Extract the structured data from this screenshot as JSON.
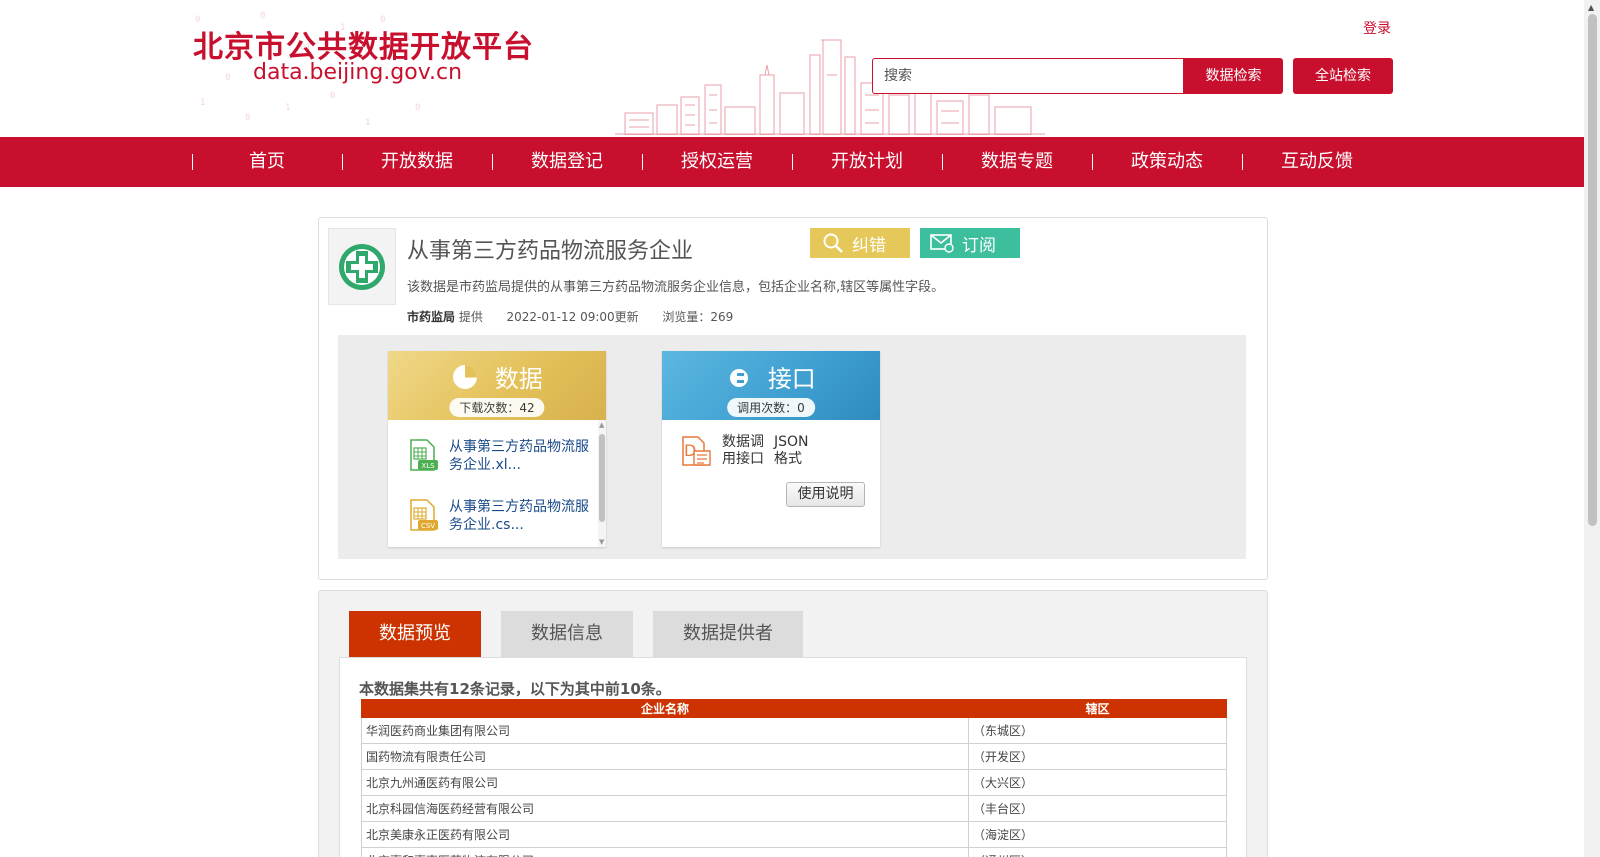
{
  "header": {
    "site_title": "北京市公共数据开放平台",
    "site_url": "data.beijing.gov.cn",
    "login_label": "登录",
    "search_placeholder": "搜索",
    "data_search_label": "数据检索",
    "site_search_label": "全站检索",
    "brand_color": "#c8102e"
  },
  "nav": {
    "items": [
      "首页",
      "开放数据",
      "数据登记",
      "授权运营",
      "开放计划",
      "数据专题",
      "政策动态",
      "互动反馈"
    ]
  },
  "dataset": {
    "icon": "medical-cross-icon",
    "title": "从事第三方药品物流服务企业",
    "correct_label": "纠错",
    "subscribe_label": "订阅",
    "description": "该数据是市药监局提供的从事第三方药品物流服务企业信息，包括企业名称,辖区等属性字段。",
    "provider": "市药监局",
    "provider_suffix": "提供",
    "updated": "2022-01-12 09:00更新",
    "views": "浏览量：269"
  },
  "resources": {
    "data": {
      "title": "数据",
      "count": "下载次数：42",
      "files": [
        {
          "icon": "xls-file-icon",
          "label": "从事第三方药品物流服务企业.xl..."
        },
        {
          "icon": "csv-file-icon",
          "label": "从事第三方药品物流服务企业.cs..."
        }
      ]
    },
    "api": {
      "title": "接口",
      "count": "调用次数：0",
      "item_label": "数据调用接口",
      "format": "JSON格式",
      "usage_label": "使用说明"
    }
  },
  "tabs": {
    "preview": "数据预览",
    "info": "数据信息",
    "provider": "数据提供者",
    "active": "数据预览"
  },
  "preview": {
    "summary": "本数据集共有12条记录，以下为其中前10条。",
    "columns": [
      "企业名称",
      "辖区"
    ],
    "rows": [
      [
        "华润医药商业集团有限公司",
        "（东城区）"
      ],
      [
        "国药物流有限责任公司",
        "（开发区）"
      ],
      [
        "北京九州通医药有限公司",
        "（大兴区）"
      ],
      [
        "北京科园信海医药经营有限公司",
        "（丰台区）"
      ],
      [
        "北京美康永正医药有限公司",
        "（海淀区）"
      ],
      [
        "北京嘉和嘉事医药物流有限公司",
        "（通州区）"
      ]
    ]
  }
}
